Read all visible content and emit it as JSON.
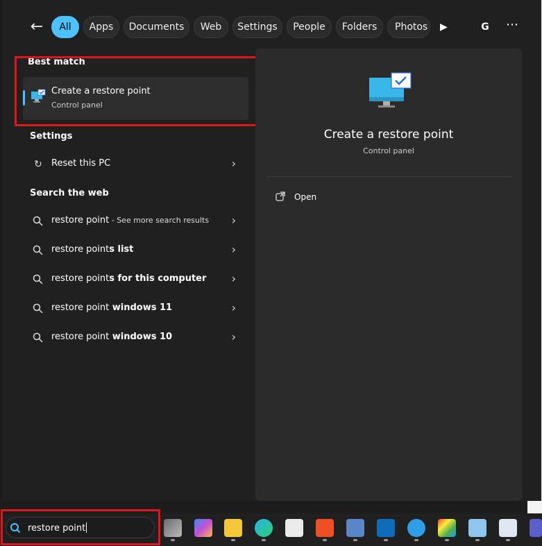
{
  "filters": {
    "chips": [
      "All",
      "Apps",
      "Documents",
      "Web",
      "Settings",
      "People",
      "Folders",
      "Photos"
    ],
    "avatar": "G"
  },
  "best_match": {
    "heading": "Best match",
    "title": "Create a restore point",
    "subtitle": "Control panel"
  },
  "settings": {
    "heading": "Settings",
    "item": "Reset this PC"
  },
  "web": {
    "heading": "Search the web",
    "results": [
      {
        "query": "restore point",
        "suffix": "",
        "hint": " - See more search results"
      },
      {
        "query": "restore point",
        "suffix": "s list",
        "hint": ""
      },
      {
        "query": "restore point",
        "suffix": "s for this computer",
        "hint": ""
      },
      {
        "query": "restore point",
        "suffix": " windows 11",
        "hint": ""
      },
      {
        "query": "restore point",
        "suffix": " windows 10",
        "hint": ""
      }
    ]
  },
  "detail": {
    "title": "Create a restore point",
    "subtitle": "Control panel",
    "action": "Open"
  },
  "taskbar": {
    "search_value": "restore point",
    "apps": [
      "task-view-icon",
      "m365-icon",
      "file-explorer-icon",
      "edge-icon",
      "store-icon",
      "brave-icon",
      "network-icon",
      "outlook-icon",
      "plus-app-icon",
      "paint-icon",
      "notepad-icon",
      "performance-monitor-icon",
      "teams-icon"
    ]
  },
  "colors": {
    "accent": "#4cc2ff",
    "highlight_box": "#e0161d"
  }
}
